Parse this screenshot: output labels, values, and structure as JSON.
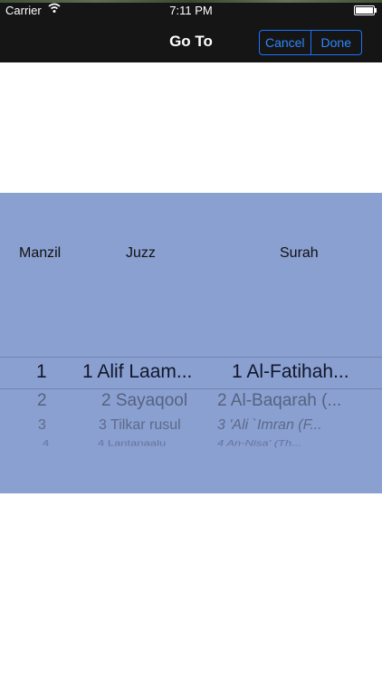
{
  "status_bar": {
    "carrier": "Carrier",
    "time": "7:11 PM",
    "wifi_icon": "wifi-icon",
    "battery_icon": "battery-icon"
  },
  "nav": {
    "title": "Go To",
    "cancel_label": "Cancel",
    "done_label": "Done",
    "accent_color": "#2f86ff"
  },
  "picker": {
    "background_color": "#8aa0d1",
    "headers": {
      "manzil": "Manzil",
      "juzz": "Juzz",
      "surah": "Surah"
    },
    "rows": [
      {
        "manzil": "1",
        "juzz": "1 Alif Laam...",
        "surah": "1 Al-Fatihah..."
      },
      {
        "manzil": "2",
        "juzz": "2 Sayaqool",
        "surah": "2 Al-Baqarah (..."
      },
      {
        "manzil": "3",
        "juzz": "3 Tilkar rusul",
        "surah": "3 'Ali `Imran (F..."
      },
      {
        "manzil": "4",
        "juzz": "4 Lantanaalu",
        "surah": "4 An-Nisa' (Th..."
      }
    ]
  }
}
